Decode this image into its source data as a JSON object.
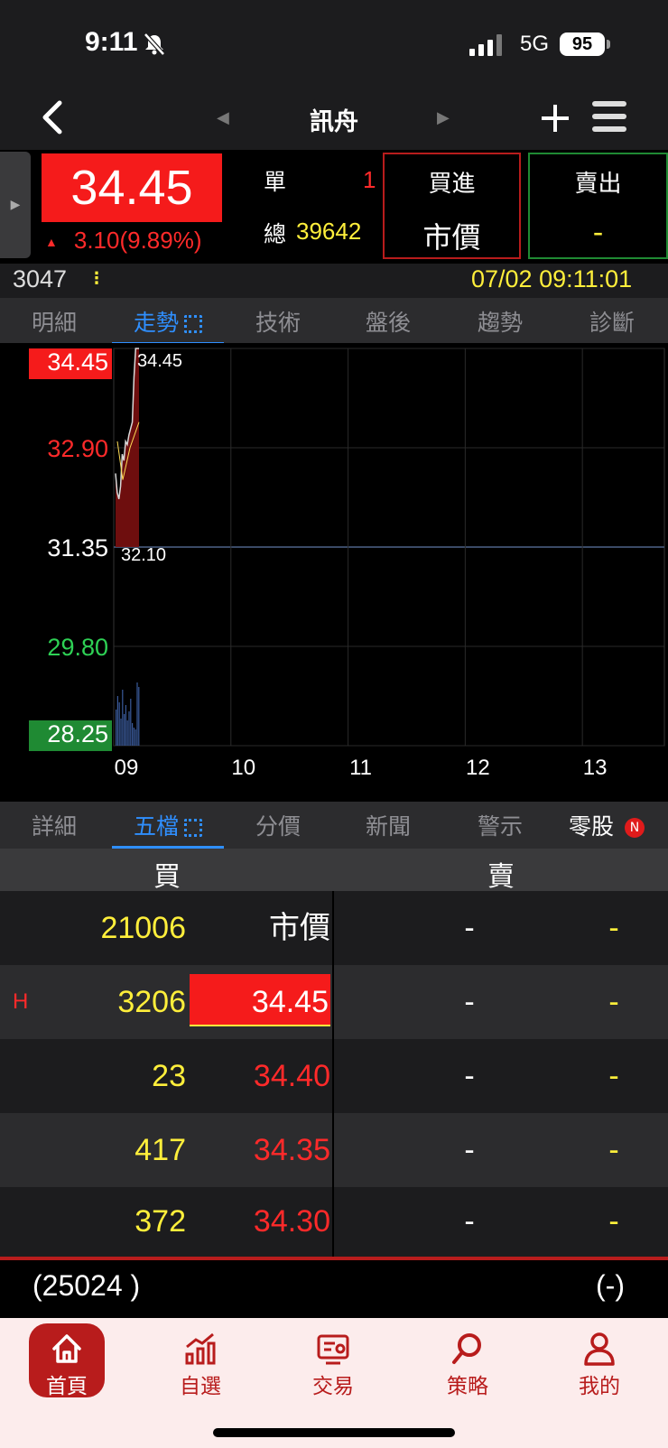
{
  "status_bar": {
    "time": "9:11",
    "network": "5G",
    "battery": "95"
  },
  "nav": {
    "title": "訊舟"
  },
  "quote": {
    "price": "34.45",
    "change": "3.10(9.89%)",
    "single_label": "單",
    "single_value": "1",
    "total_label": "總",
    "total_value": "39642",
    "buy_label": "買進",
    "buy_type": "市價",
    "sell_label": "賣出",
    "sell_value": "-",
    "code": "3047",
    "datetime": "07/02 09:11:01"
  },
  "top_tabs": [
    {
      "label": "明細"
    },
    {
      "label": "走勢"
    },
    {
      "label": "技術"
    },
    {
      "label": "盤後"
    },
    {
      "label": "趨勢"
    },
    {
      "label": "診斷"
    }
  ],
  "chart_data": {
    "type": "line",
    "y_ticks": [
      "34.45",
      "32.90",
      "31.35",
      "29.80",
      "28.25"
    ],
    "y_range": [
      28.25,
      34.45
    ],
    "reference_price": 31.35,
    "x_ticks": [
      "09",
      "10",
      "11",
      "12",
      "13"
    ],
    "annotations": {
      "high": "34.45",
      "low": "32.10"
    },
    "series": [
      {
        "x": [
          0,
          1,
          2,
          3,
          4,
          5,
          6,
          7,
          8,
          9,
          10,
          11,
          12,
          13,
          14
        ],
        "values": [
          32.5,
          32.2,
          32.1,
          32.3,
          32.8,
          32.7,
          33.0,
          32.95,
          33.1,
          33.2,
          33.3,
          34.0,
          34.45,
          34.45,
          34.45
        ]
      }
    ],
    "volume": [
      40,
      55,
      48,
      30,
      62,
      35,
      45,
      28,
      38,
      52,
      25,
      20,
      18,
      70,
      65
    ]
  },
  "sub_tabs": [
    {
      "label": "詳細"
    },
    {
      "label": "五檔"
    },
    {
      "label": "分價"
    },
    {
      "label": "新聞"
    },
    {
      "label": "警示"
    },
    {
      "label": "零股",
      "badge": "N"
    }
  ],
  "order_book": {
    "buy_header": "買",
    "sell_header": "賣",
    "rows": [
      {
        "marker": "",
        "bid_qty": "21006",
        "bid_price": "市價",
        "ask_price": "-",
        "ask_qty": "-"
      },
      {
        "marker": "H",
        "bid_qty": "3206",
        "bid_price": "34.45",
        "ask_price": "-",
        "ask_qty": "-"
      },
      {
        "marker": "",
        "bid_qty": "23",
        "bid_price": "34.40",
        "ask_price": "-",
        "ask_qty": "-"
      },
      {
        "marker": "",
        "bid_qty": "417",
        "bid_price": "34.35",
        "ask_price": "-",
        "ask_qty": "-"
      },
      {
        "marker": "",
        "bid_qty": "372",
        "bid_price": "34.30",
        "ask_price": "-",
        "ask_qty": "-"
      }
    ],
    "bid_total": "(25024 )",
    "ask_total": "(-)"
  },
  "bottom_nav": [
    {
      "label": "首頁",
      "icon": "home-icon"
    },
    {
      "label": "自選",
      "icon": "chart-bars-icon"
    },
    {
      "label": "交易",
      "icon": "trade-icon"
    },
    {
      "label": "策略",
      "icon": "search-icon"
    },
    {
      "label": "我的",
      "icon": "user-icon"
    }
  ],
  "colors": {
    "up": "#ff2a2a",
    "down": "#1f8a33",
    "accent": "#2f8fff",
    "brand": "#b81c1c",
    "qty": "#ffef3b"
  }
}
